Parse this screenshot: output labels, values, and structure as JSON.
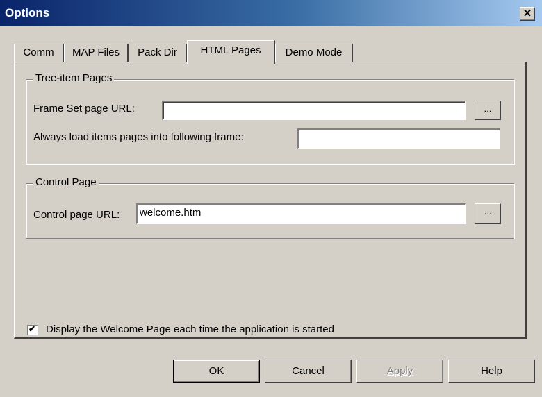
{
  "window": {
    "title": "Options",
    "close_glyph": "✕"
  },
  "tabs": [
    {
      "label": "Comm",
      "active": false
    },
    {
      "label": "MAP Files",
      "active": false
    },
    {
      "label": "Pack Dir",
      "active": false
    },
    {
      "label": "HTML Pages",
      "active": true
    },
    {
      "label": "Demo Mode",
      "active": false
    }
  ],
  "tree_group": {
    "legend": "Tree-item Pages",
    "frameset_label": "Frame Set page URL:",
    "frameset_value": "",
    "frame_label": "Always load items pages into following frame:",
    "frame_value": "",
    "browse_label": "..."
  },
  "control_group": {
    "legend": "Control Page",
    "url_label": "Control page URL:",
    "url_value": "welcome.htm",
    "browse_label": "..."
  },
  "welcome_checkbox": {
    "label": "Display the Welcome Page each time the application is started",
    "checked": true,
    "check_glyph": "✔"
  },
  "buttons": {
    "ok": "OK",
    "cancel": "Cancel",
    "apply": "Apply",
    "help": "Help"
  }
}
